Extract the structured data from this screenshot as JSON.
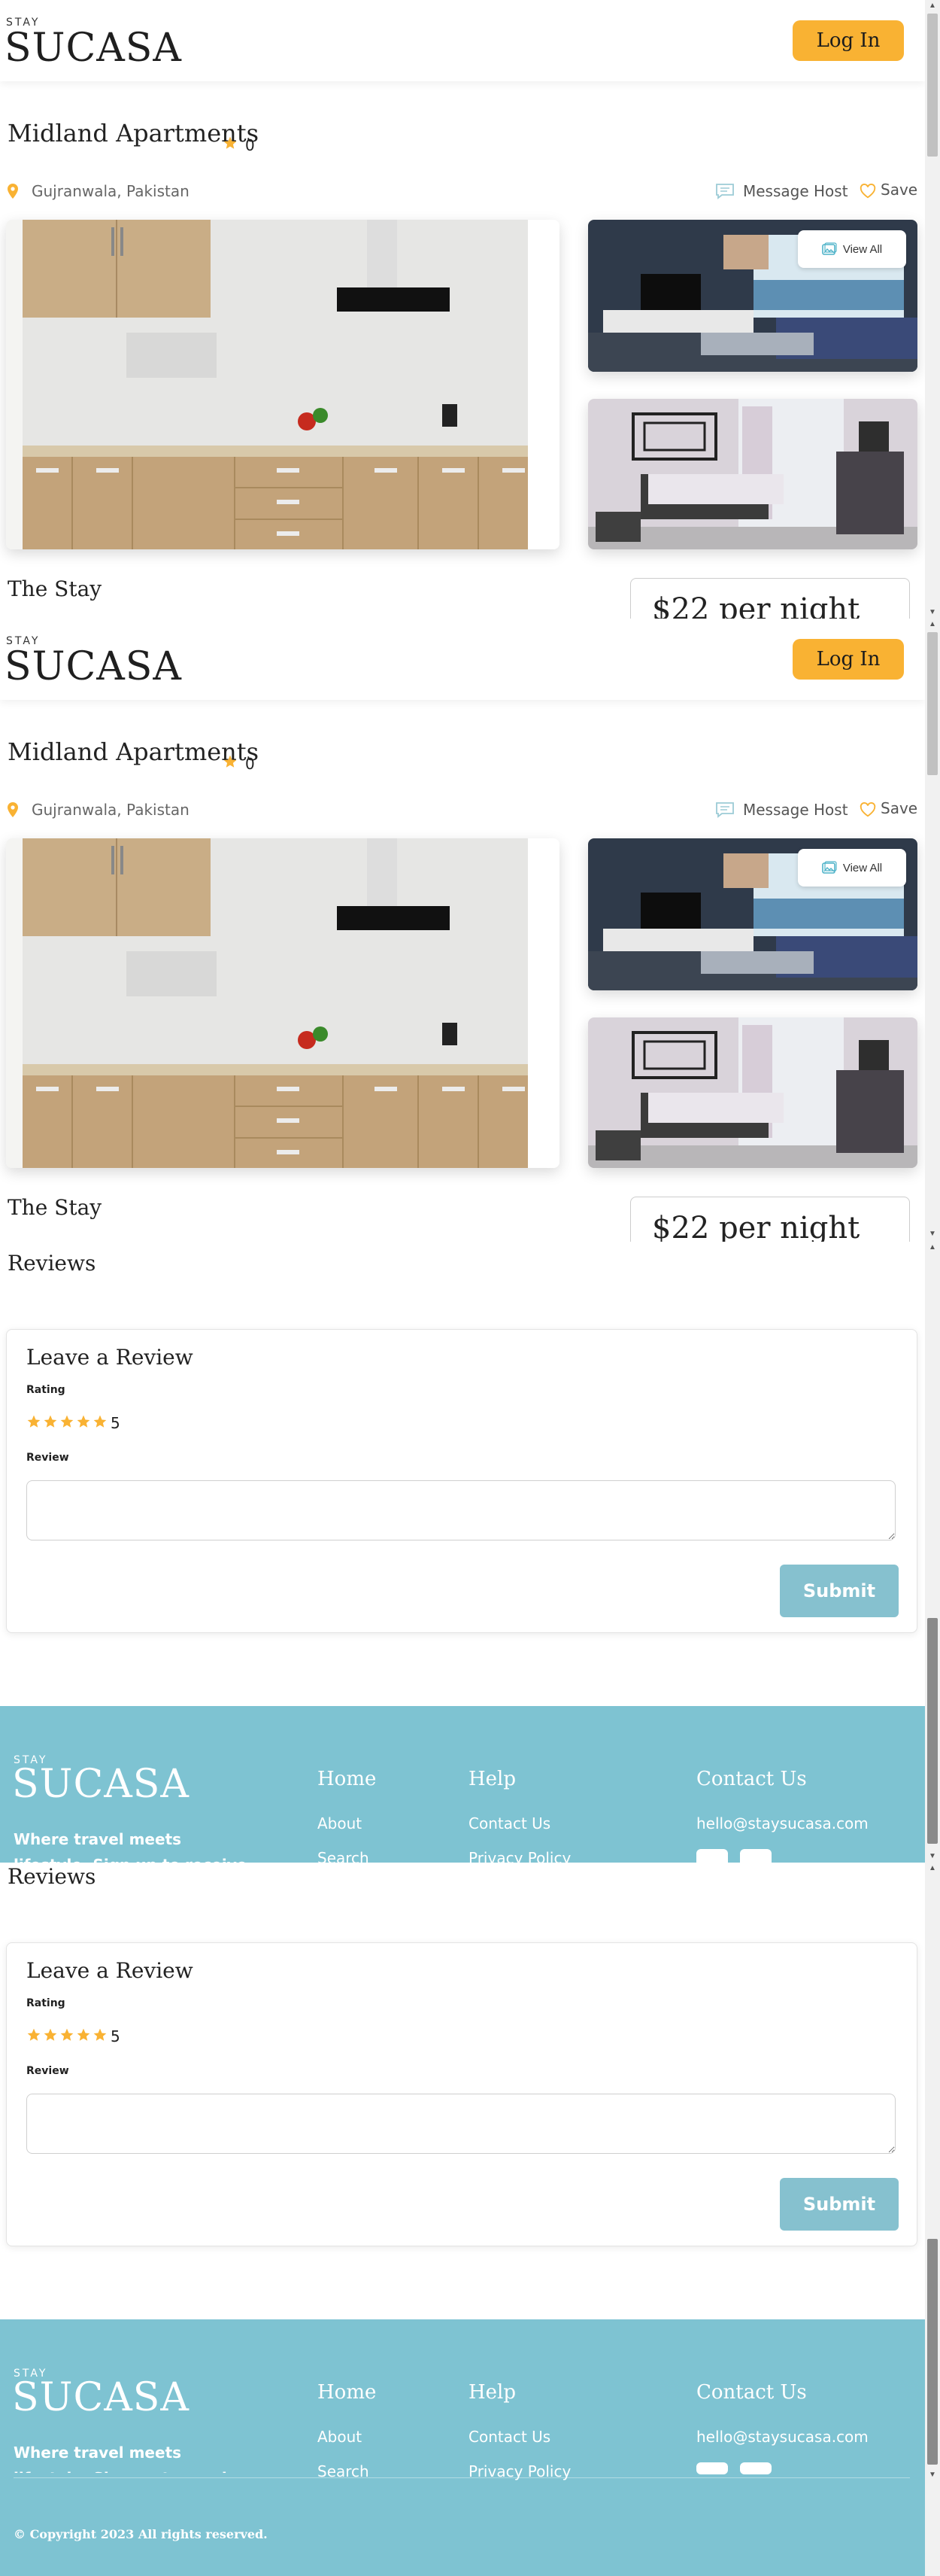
{
  "header": {
    "logo_small": "STAY",
    "logo_big": "SUCASA",
    "login_label": "Log In"
  },
  "listing": {
    "title": "Midland Apartments",
    "rating_count": "0",
    "location": "Gujranwala, Pakistan",
    "message_host": "Message Host",
    "save": "Save",
    "view_all": "View All",
    "section_title": "The Stay",
    "price": "$22 per night"
  },
  "reviews": {
    "title": "Reviews",
    "form_title": "Leave a Review",
    "rating_label": "Rating",
    "rating_value": "5",
    "review_label": "Review",
    "submit_label": "Submit"
  },
  "footer": {
    "logo_small": "STAY",
    "logo_big": "SUCASA",
    "tagline": "Where travel meets lifestyle. Sign up to receive",
    "col_home": {
      "title": "Home",
      "links": [
        "About",
        "Search"
      ]
    },
    "col_help": {
      "title": "Help",
      "links": [
        "Contact Us",
        "Privacy Policy"
      ]
    },
    "col_contact": {
      "title": "Contact Us",
      "email": "hello@staysucasa.com"
    },
    "copyright": "© Copyright 2023 All rights reserved."
  },
  "colors": {
    "accent": "#f9b233",
    "footer_bg": "#7ec3d2",
    "submit_bg": "#86c1cf"
  }
}
